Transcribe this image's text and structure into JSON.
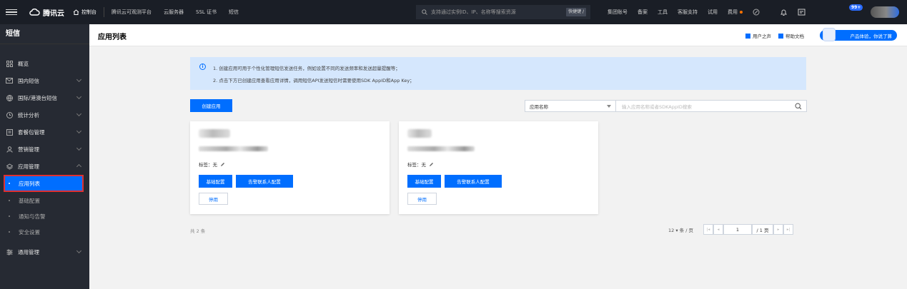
{
  "topbar": {
    "brand": "腾讯云",
    "console": "控制台",
    "nav": [
      "腾讯云可观测平台",
      "云服务器",
      "SSL 证书",
      "短信"
    ],
    "search_placeholder": "支持通过实例ID、IP、名称等搜索资源",
    "shortcut": "快捷键 /",
    "right": [
      "集团账号",
      "备案",
      "工具",
      "客服支持",
      "试用",
      "费用"
    ],
    "notify_count": "99+"
  },
  "sidebar": {
    "title": "短信",
    "items": [
      {
        "label": "概览",
        "icon": "grid-icon"
      },
      {
        "label": "国内短信",
        "icon": "mail-icon"
      },
      {
        "label": "国际/港澳台短信",
        "icon": "globe-icon"
      },
      {
        "label": "统计分析",
        "icon": "clock-icon"
      },
      {
        "label": "套餐包管理",
        "icon": "package-icon"
      },
      {
        "label": "营销管理",
        "icon": "user-icon"
      },
      {
        "label": "应用管理",
        "icon": "layers-icon"
      }
    ],
    "subitems": [
      "应用列表",
      "基础配置",
      "通知与告警",
      "安全设置"
    ],
    "last_item": {
      "label": "通用管理",
      "icon": "settings-icon"
    }
  },
  "header": {
    "title": "应用列表",
    "links": [
      "用户之声",
      "帮助文档"
    ],
    "promo": "产品体验，你说了算"
  },
  "notice": {
    "line1": "1. 创建应用可用于个性化管理短信发送任务，例如设置不同的发送频率和发送超量提醒等；",
    "line2": "2. 点击下方已创建应用查看应用详情，调用短信API发送短信时需要使用SDK AppID和App Key；"
  },
  "toolbar": {
    "create_label": "创建应用",
    "filter_label": "应用名称",
    "filter_placeholder": "输入应用名称或者SDKAppID搜索"
  },
  "cards": [
    {
      "tag_label": "标签：无",
      "btn_basic": "基础配置",
      "btn_alarm": "告警联系人配置",
      "btn_disable": "停用"
    },
    {
      "tag_label": "标签：无",
      "btn_basic": "基础配置",
      "btn_alarm": "告警联系人配置",
      "btn_disable": "停用"
    }
  ],
  "footer": {
    "total": "共 2 条",
    "page_size": "12 ▾ 条 / 页",
    "page": "1",
    "page_total": "/ 1 页"
  },
  "colors": {
    "accent": "#006eff",
    "sidebar_bg": "#262a33",
    "topbar_bg": "#1a1e26",
    "highlight": "#e03030"
  }
}
